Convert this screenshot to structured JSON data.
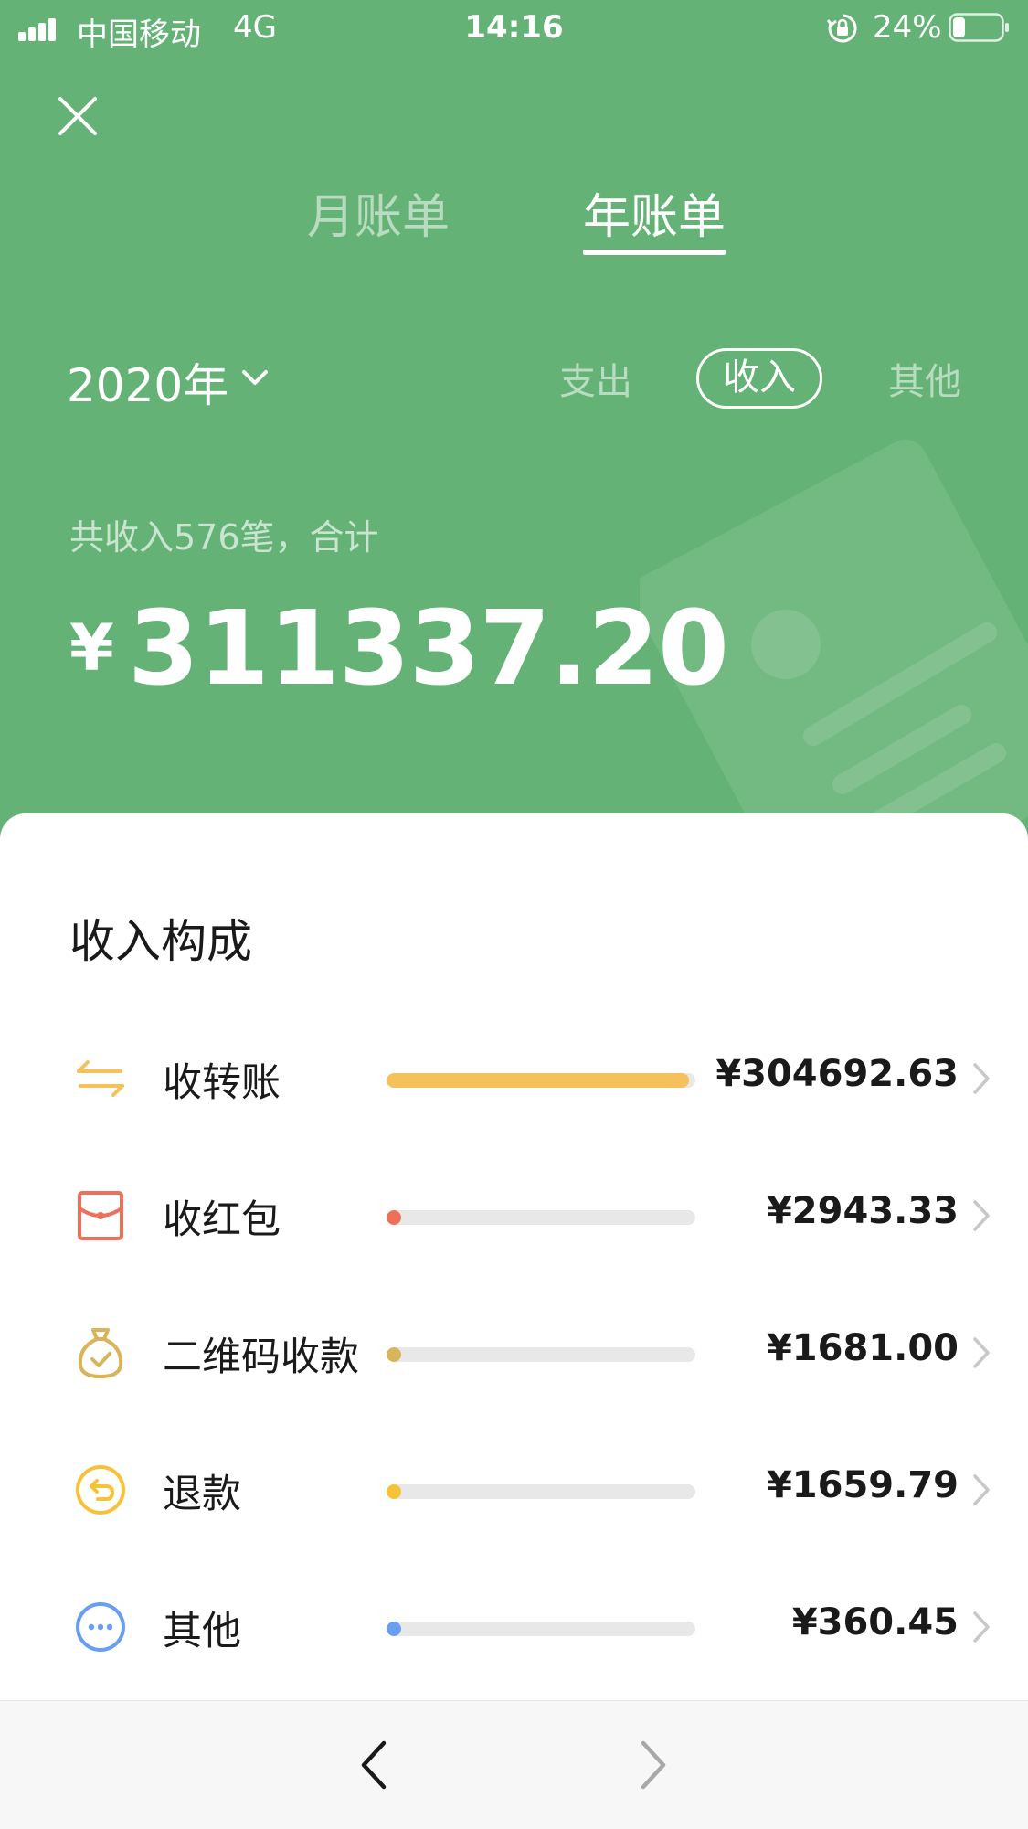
{
  "status_bar": {
    "carrier": "中国移动",
    "network": "4G",
    "time": "14:16",
    "battery": "24%",
    "icons": [
      "signal-icon",
      "orientation-lock-icon",
      "battery-icon"
    ]
  },
  "header": {
    "close_icon": "close-icon",
    "tabs": [
      {
        "label": "月账单",
        "active": false
      },
      {
        "label": "年账单",
        "active": true
      }
    ],
    "year": "2020年",
    "filters": [
      {
        "label": "支出",
        "active": false
      },
      {
        "label": "收入",
        "active": true
      },
      {
        "label": "其他",
        "active": false
      }
    ],
    "summary": "共收入576笔，合计",
    "currency": "¥",
    "total": "311337.20"
  },
  "colors": {
    "header_bg": "#64b276",
    "transfer": "#f5c15a",
    "red_packet": "#ef705a",
    "qr_payment": "#d9b559",
    "refund": "#f6c237",
    "other": "#6a9ef2",
    "track": "#e8e8e8"
  },
  "breakdown": {
    "title": "收入构成",
    "items": [
      {
        "label": "收转账",
        "amount": "¥304692.63",
        "share": 0.9787,
        "icon": "transfer-icon",
        "color": "#f5c15a"
      },
      {
        "label": "收红包",
        "amount": "¥2943.33",
        "share": 0.0095,
        "icon": "red-packet-icon",
        "color": "#ef705a"
      },
      {
        "label": "二维码收款",
        "amount": "¥1681.00",
        "share": 0.0054,
        "icon": "money-bag-icon",
        "color": "#d9b559"
      },
      {
        "label": "退款",
        "amount": "¥1659.79",
        "share": 0.0053,
        "icon": "refund-icon",
        "color": "#f6c237"
      },
      {
        "label": "其他",
        "amount": "¥360.45",
        "share": 0.0012,
        "icon": "more-icon",
        "color": "#6a9ef2"
      }
    ]
  },
  "bottom_nav": {
    "back_icon": "back-arrow-icon",
    "forward_icon": "forward-arrow-icon"
  }
}
